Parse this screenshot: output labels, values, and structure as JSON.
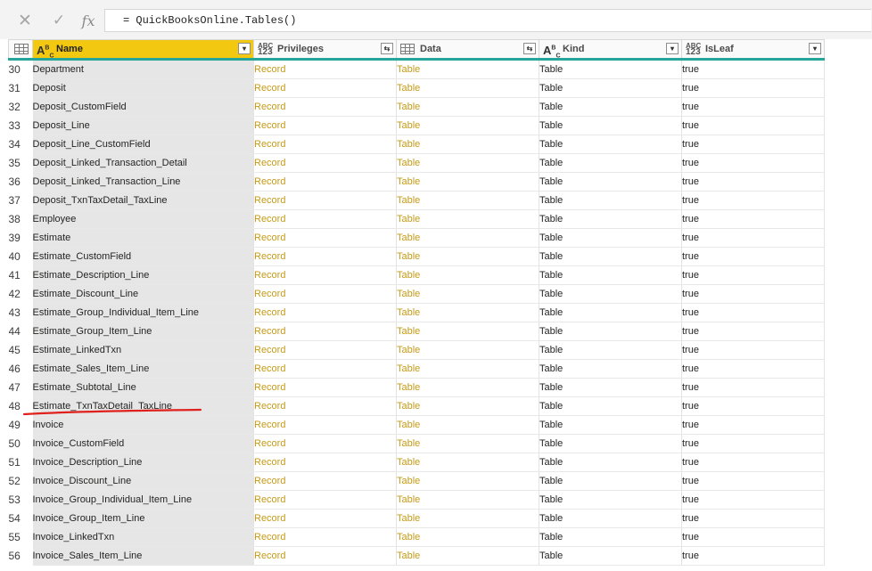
{
  "formula_bar": {
    "cancel_icon": "close-icon",
    "commit_icon": "check-icon",
    "fx_label": "fx",
    "formula": "= QuickBooksOnline.Tables()"
  },
  "columns": [
    {
      "type": "ABC",
      "label": "Name",
      "control": "dropdown"
    },
    {
      "type": "ABC 123",
      "label": "Privileges",
      "control": "expand"
    },
    {
      "type": "table-icon",
      "label": "Data",
      "control": "expand"
    },
    {
      "type": "ABC",
      "label": "Kind",
      "control": "dropdown"
    },
    {
      "type": "ABC 123",
      "label": "IsLeaf",
      "control": "dropdown"
    }
  ],
  "rows": [
    {
      "n": "30",
      "name": "Department",
      "privileges": "Record",
      "data": "Table",
      "kind": "Table",
      "isleaf": "true"
    },
    {
      "n": "31",
      "name": "Deposit",
      "privileges": "Record",
      "data": "Table",
      "kind": "Table",
      "isleaf": "true"
    },
    {
      "n": "32",
      "name": "Deposit_CustomField",
      "privileges": "Record",
      "data": "Table",
      "kind": "Table",
      "isleaf": "true"
    },
    {
      "n": "33",
      "name": "Deposit_Line",
      "privileges": "Record",
      "data": "Table",
      "kind": "Table",
      "isleaf": "true"
    },
    {
      "n": "34",
      "name": "Deposit_Line_CustomField",
      "privileges": "Record",
      "data": "Table",
      "kind": "Table",
      "isleaf": "true"
    },
    {
      "n": "35",
      "name": "Deposit_Linked_Transaction_Detail",
      "privileges": "Record",
      "data": "Table",
      "kind": "Table",
      "isleaf": "true"
    },
    {
      "n": "36",
      "name": "Deposit_Linked_Transaction_Line",
      "privileges": "Record",
      "data": "Table",
      "kind": "Table",
      "isleaf": "true"
    },
    {
      "n": "37",
      "name": "Deposit_TxnTaxDetail_TaxLine",
      "privileges": "Record",
      "data": "Table",
      "kind": "Table",
      "isleaf": "true"
    },
    {
      "n": "38",
      "name": "Employee",
      "privileges": "Record",
      "data": "Table",
      "kind": "Table",
      "isleaf": "true"
    },
    {
      "n": "39",
      "name": "Estimate",
      "privileges": "Record",
      "data": "Table",
      "kind": "Table",
      "isleaf": "true"
    },
    {
      "n": "40",
      "name": "Estimate_CustomField",
      "privileges": "Record",
      "data": "Table",
      "kind": "Table",
      "isleaf": "true"
    },
    {
      "n": "41",
      "name": "Estimate_Description_Line",
      "privileges": "Record",
      "data": "Table",
      "kind": "Table",
      "isleaf": "true"
    },
    {
      "n": "42",
      "name": "Estimate_Discount_Line",
      "privileges": "Record",
      "data": "Table",
      "kind": "Table",
      "isleaf": "true"
    },
    {
      "n": "43",
      "name": "Estimate_Group_Individual_Item_Line",
      "privileges": "Record",
      "data": "Table",
      "kind": "Table",
      "isleaf": "true"
    },
    {
      "n": "44",
      "name": "Estimate_Group_Item_Line",
      "privileges": "Record",
      "data": "Table",
      "kind": "Table",
      "isleaf": "true"
    },
    {
      "n": "45",
      "name": "Estimate_LinkedTxn",
      "privileges": "Record",
      "data": "Table",
      "kind": "Table",
      "isleaf": "true"
    },
    {
      "n": "46",
      "name": "Estimate_Sales_Item_Line",
      "privileges": "Record",
      "data": "Table",
      "kind": "Table",
      "isleaf": "true"
    },
    {
      "n": "47",
      "name": "Estimate_Subtotal_Line",
      "privileges": "Record",
      "data": "Table",
      "kind": "Table",
      "isleaf": "true"
    },
    {
      "n": "48",
      "name": "Estimate_TxnTaxDetail_TaxLine",
      "privileges": "Record",
      "data": "Table",
      "kind": "Table",
      "isleaf": "true"
    },
    {
      "n": "49",
      "name": "Invoice",
      "privileges": "Record",
      "data": "Table",
      "kind": "Table",
      "isleaf": "true"
    },
    {
      "n": "50",
      "name": "Invoice_CustomField",
      "privileges": "Record",
      "data": "Table",
      "kind": "Table",
      "isleaf": "true"
    },
    {
      "n": "51",
      "name": "Invoice_Description_Line",
      "privileges": "Record",
      "data": "Table",
      "kind": "Table",
      "isleaf": "true"
    },
    {
      "n": "52",
      "name": "Invoice_Discount_Line",
      "privileges": "Record",
      "data": "Table",
      "kind": "Table",
      "isleaf": "true"
    },
    {
      "n": "53",
      "name": "Invoice_Group_Individual_Item_Line",
      "privileges": "Record",
      "data": "Table",
      "kind": "Table",
      "isleaf": "true"
    },
    {
      "n": "54",
      "name": "Invoice_Group_Item_Line",
      "privileges": "Record",
      "data": "Table",
      "kind": "Table",
      "isleaf": "true"
    },
    {
      "n": "55",
      "name": "Invoice_LinkedTxn",
      "privileges": "Record",
      "data": "Table",
      "kind": "Table",
      "isleaf": "true"
    },
    {
      "n": "56",
      "name": "Invoice_Sales_Item_Line",
      "privileges": "Record",
      "data": "Table",
      "kind": "Table",
      "isleaf": "true"
    }
  ],
  "colors": {
    "selected_header": "#f2c811",
    "header_underline": "#26a69a",
    "link_text": "#c79b17",
    "annotation": "#e0201c"
  },
  "annotation": {
    "type": "red-underline",
    "row": "48"
  }
}
